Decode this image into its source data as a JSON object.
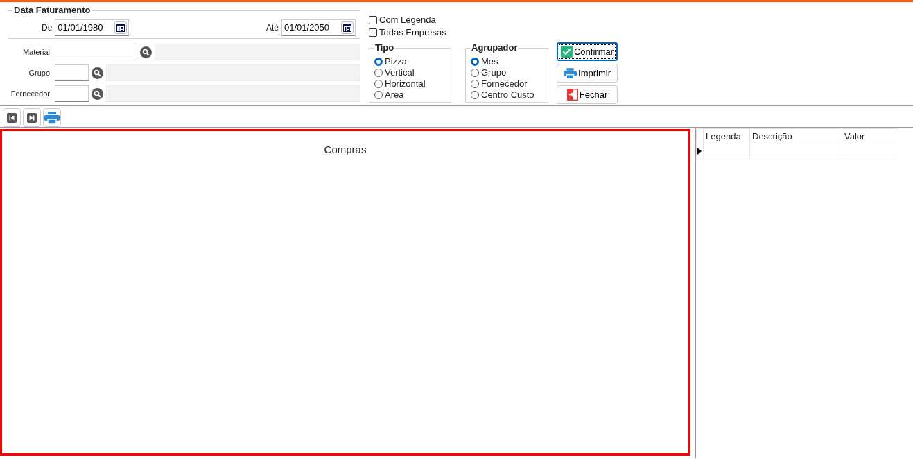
{
  "billing_date": {
    "title": "Data Faturamento",
    "from": {
      "label": "De",
      "value": "01/01/1980"
    },
    "to": {
      "label": "Até",
      "value": "01/01/2050"
    }
  },
  "lookups": [
    {
      "label": "Material",
      "kind": "long"
    },
    {
      "label": "Grupo",
      "kind": "short"
    },
    {
      "label": "Fornecedor",
      "kind": "short"
    }
  ],
  "options": [
    {
      "label": "Com Legenda",
      "checked": false
    },
    {
      "label": "Todas Empresas",
      "checked": false
    }
  ],
  "radio_groups": [
    {
      "title": "Tipo",
      "items": [
        {
          "label": "Pizza",
          "selected": true
        },
        {
          "label": "Vertical",
          "selected": false
        },
        {
          "label": "Horizontal",
          "selected": false
        },
        {
          "label": "Area",
          "selected": false
        }
      ]
    },
    {
      "title": "Agrupador",
      "items": [
        {
          "label": "Mes",
          "selected": true
        },
        {
          "label": "Grupo",
          "selected": false
        },
        {
          "label": "Fornecedor",
          "selected": false
        },
        {
          "label": "Centro Custo",
          "selected": false
        }
      ]
    }
  ],
  "buttons": [
    {
      "label": "Confirmar",
      "kind": "confirm",
      "focused": true
    },
    {
      "label": "Imprimir",
      "kind": "print",
      "focused": false
    },
    {
      "label": "Fechar",
      "kind": "close",
      "focused": false
    }
  ],
  "toolbar": [
    {
      "kind": "first"
    },
    {
      "kind": "last"
    },
    {
      "kind": "print"
    }
  ],
  "chart": {
    "title": "Compras"
  },
  "legend_table": {
    "columns": [
      "Legenda",
      "Descrição",
      "Valor"
    ],
    "current_row": true
  }
}
